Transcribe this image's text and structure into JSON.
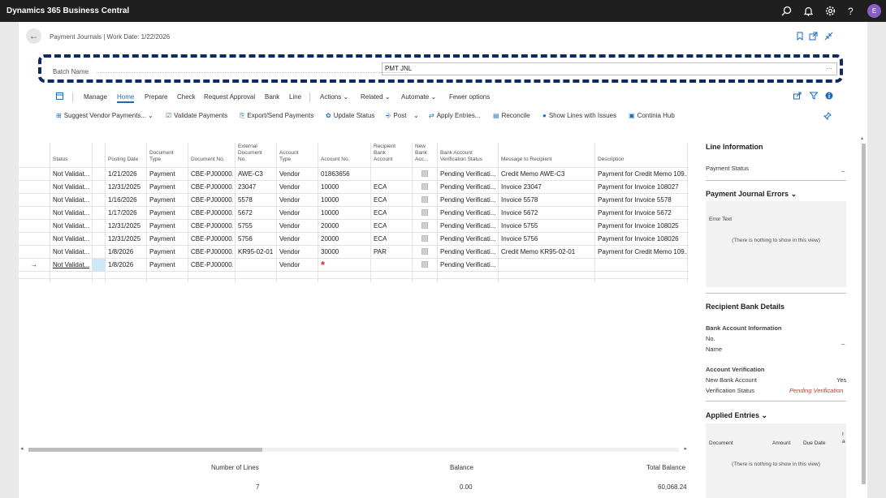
{
  "app": {
    "title": "Dynamics 365 Business Central",
    "avatar_initial": "E"
  },
  "header": {
    "title": "Payment Journals | Work Date: 1/22/2026"
  },
  "batch": {
    "label": "Batch Name",
    "value": "PMT JNL",
    "more": "···"
  },
  "menu": {
    "items": [
      "Manage",
      "Home",
      "Prepare",
      "Check",
      "Request Approval",
      "Bank",
      "Line"
    ],
    "active": "Home",
    "actions": "Actions",
    "related": "Related",
    "automate": "Automate",
    "fewer": "Fewer options"
  },
  "actions": {
    "suggest": "Suggest Vendor Payments...",
    "validate": "Validate Payments",
    "export": "Export/Send Payments",
    "update": "Update Status",
    "post": "Post",
    "apply": "Apply Entries...",
    "reconcile": "Reconcile",
    "show_issues": "Show Lines with Issues",
    "continia": "Continia Hub"
  },
  "grid": {
    "columns": {
      "status": "Status",
      "posting_date": "Posting Date",
      "document_type": [
        "Document",
        "Type"
      ],
      "document_no": "Document No.",
      "external_doc": [
        "External",
        "Document",
        "No."
      ],
      "account_type": [
        "Account",
        "Type"
      ],
      "account_no": "Account No.",
      "recipient_bank": [
        "Recipient",
        "Bank",
        "Account"
      ],
      "new_bank": [
        "New",
        "Bank",
        "Acc..."
      ],
      "verification": [
        "Bank Account",
        "Verification Status"
      ],
      "message": "Message to Recipient",
      "description": "Description"
    },
    "rows": [
      {
        "status": "Not Validat...",
        "date": "1/21/2026",
        "doctype": "Payment",
        "docno": "CBE-PJ00000...",
        "ext": "AWE-C3",
        "acctype": "Vendor",
        "accno": "01863656",
        "bank": "",
        "verif": "Pending Verificati...",
        "msg": "Credit Memo AWE-C3",
        "desc": "Payment for Credit Memo 109..."
      },
      {
        "status": "Not Validat...",
        "date": "12/31/2025",
        "doctype": "Payment",
        "docno": "CBE-PJ00000...",
        "ext": "23047",
        "acctype": "Vendor",
        "accno": "10000",
        "bank": "ECA",
        "verif": "Pending Verificati...",
        "msg": "Invoice 23047",
        "desc": "Payment for Invoice 108027"
      },
      {
        "status": "Not Validat...",
        "date": "1/16/2026",
        "doctype": "Payment",
        "docno": "CBE-PJ00000...",
        "ext": "5578",
        "acctype": "Vendor",
        "accno": "10000",
        "bank": "ECA",
        "verif": "Pending Verificati...",
        "msg": "Invoice 5578",
        "desc": "Payment for Invoice 5578"
      },
      {
        "status": "Not Validat...",
        "date": "1/17/2026",
        "doctype": "Payment",
        "docno": "CBE-PJ00000...",
        "ext": "5672",
        "acctype": "Vendor",
        "accno": "10000",
        "bank": "ECA",
        "verif": "Pending Verificati...",
        "msg": "Invoice 5672",
        "desc": "Payment for Invoice 5672"
      },
      {
        "status": "Not Validat...",
        "date": "12/31/2025",
        "doctype": "Payment",
        "docno": "CBE-PJ00000...",
        "ext": "5755",
        "acctype": "Vendor",
        "accno": "20000",
        "bank": "ECA",
        "verif": "Pending Verificati...",
        "msg": "Invoice 5755",
        "desc": "Payment for Invoice 108025"
      },
      {
        "status": "Not Validat...",
        "date": "12/31/2025",
        "doctype": "Payment",
        "docno": "CBE-PJ00000...",
        "ext": "5756",
        "acctype": "Vendor",
        "accno": "20000",
        "bank": "ECA",
        "verif": "Pending Verificati...",
        "msg": "Invoice 5756",
        "desc": "Payment for Invoice 108026"
      },
      {
        "status": "Not Validat...",
        "date": "1/8/2026",
        "doctype": "Payment",
        "docno": "CBE-PJ00000...",
        "ext": "KR95-02-01",
        "acctype": "Vendor",
        "accno": "30000",
        "bank": "PAR",
        "verif": "Pending Verificati...",
        "msg": "Credit Memo KR95-02-01",
        "desc": "Payment for Credit Memo 109..."
      },
      {
        "status": "Not Validat...",
        "date": "1/8/2026",
        "doctype": "Payment",
        "docno": "CBE-PJ00000...",
        "ext": "",
        "acctype": "Vendor",
        "accno": "",
        "bank": "",
        "verif": "Pending Verificati...",
        "msg": "",
        "desc": ""
      }
    ],
    "current_row_marker": "→",
    "required_marker": "*"
  },
  "footer": {
    "lines_label": "Number of Lines",
    "lines_value": "7",
    "balance_label": "Balance",
    "balance_value": "0.00",
    "total_label": "Total Balance",
    "total_value": "60,068.24"
  },
  "factbox": {
    "line_info_title": "Line Information",
    "payment_status_label": "Payment Status",
    "payment_status_value": "_",
    "errors_title": "Payment Journal Errors",
    "error_text_label": "Error Text",
    "empty_text": "(There is nothing to show in this view)",
    "recipient_title": "Recipient Bank Details",
    "bank_info_label": "Bank Account Information",
    "no_label": "No.",
    "no_value": "_",
    "name_label": "Name",
    "verification_title": "Account Verification",
    "new_bank_label": "New Bank Account",
    "new_bank_value": "Yes",
    "verif_status_label": "Verification Status",
    "verif_status_value": "Pending Verification",
    "applied_title": "Applied Entries",
    "col_document": "Document",
    "col_amount": "Amount",
    "col_due": "Due Date",
    "col_extra": "I\na"
  },
  "colors": {
    "accent": "#1b6bb8",
    "topbar": "#1f1f1f",
    "dashed_border": "#0d2a63",
    "required": "#d62b2b",
    "warning_text": "#c0392b"
  }
}
